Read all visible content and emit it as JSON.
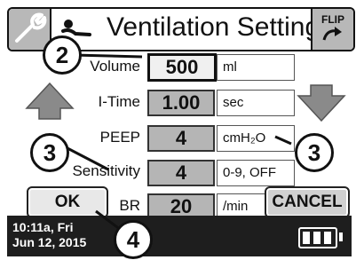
{
  "header": {
    "title": "Ventilation Settings",
    "flip_label": "FLIP"
  },
  "params": [
    {
      "label": "Volume",
      "value": "500",
      "unit": "ml",
      "active": true
    },
    {
      "label": "I-Time",
      "value": "1.00",
      "unit": "sec",
      "active": false
    },
    {
      "label": "PEEP",
      "value": "4",
      "unit": "cmH₂O",
      "active": false
    },
    {
      "label": "Sensitivity",
      "value": "4",
      "unit": "0-9, OFF",
      "active": false
    },
    {
      "label": "BR",
      "value": "20",
      "unit": "/min",
      "active": false
    }
  ],
  "buttons": {
    "ok": "OK",
    "cancel": "CANCEL"
  },
  "footer": {
    "time": "10:11a, Fri",
    "date": "Jun 12, 2015"
  },
  "battery": {
    "level_fraction": 1.0
  },
  "callouts": {
    "top": "2",
    "left": "3",
    "right": "3",
    "bottom": "4"
  }
}
